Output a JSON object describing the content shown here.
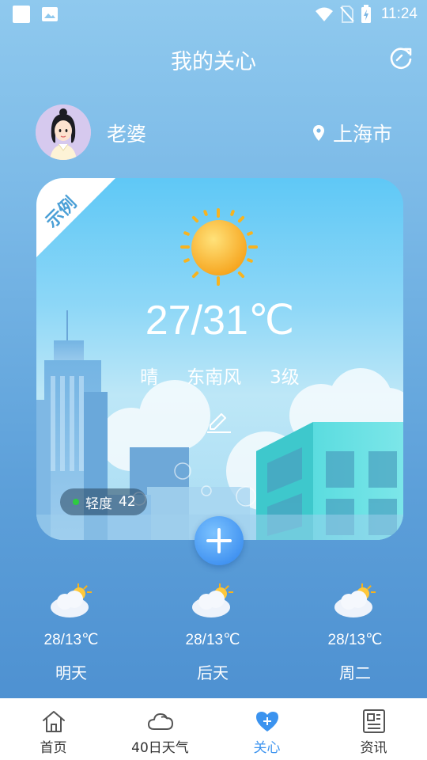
{
  "status_bar": {
    "time": "11:24",
    "icons": [
      "notification-square-icon",
      "image-icon",
      "wifi-icon",
      "no-sim-icon",
      "battery-charging-icon"
    ]
  },
  "header": {
    "title": "我的关心",
    "refresh_icon": "refresh-icon"
  },
  "profile": {
    "name": "老婆",
    "location": "上海市",
    "location_icon": "location-pin-icon"
  },
  "card": {
    "ribbon_label": "示例",
    "temperature": "27/31℃",
    "condition": "晴",
    "wind_direction": "东南风",
    "wind_level": "3级",
    "aqi_label": "轻度",
    "aqi_value": "42",
    "aqi_color": "#2ecc40"
  },
  "forecast": [
    {
      "temp": "28/13℃",
      "day": "明天",
      "icon": "partly-cloudy-icon"
    },
    {
      "temp": "28/13℃",
      "day": "后天",
      "icon": "partly-cloudy-icon"
    },
    {
      "temp": "28/13℃",
      "day": "周二",
      "icon": "partly-cloudy-icon"
    }
  ],
  "nav": [
    {
      "label": "首页",
      "icon": "home-icon",
      "active": false
    },
    {
      "label": "40日天气",
      "icon": "cloud-icon",
      "active": false
    },
    {
      "label": "关心",
      "icon": "heart-icon",
      "active": true
    },
    {
      "label": "资讯",
      "icon": "news-icon",
      "active": false
    }
  ],
  "colors": {
    "accent": "#3b93ef",
    "background_top": "#8fc9ee",
    "background_bottom": "#4a8dcf"
  }
}
